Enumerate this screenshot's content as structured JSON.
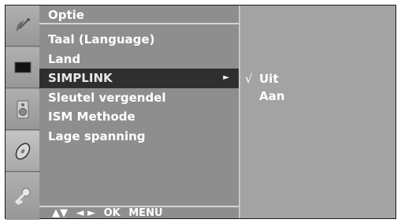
{
  "icons": [
    {
      "name": "satellite-dish-icon"
    },
    {
      "name": "screen-icon"
    },
    {
      "name": "speaker-icon"
    },
    {
      "name": "disc-icon"
    },
    {
      "name": "key-icon"
    }
  ],
  "menu": {
    "title": "Optie",
    "items": [
      {
        "label": "Taal (Language)"
      },
      {
        "label": "Land"
      },
      {
        "label": "SIMPLINK",
        "selected": true,
        "arrow": "►"
      },
      {
        "label": "Sleutel vergendel"
      },
      {
        "label": "ISM Methode"
      },
      {
        "label": "Lage spanning"
      }
    ],
    "footer": {
      "updown": "▲▼",
      "leftright": "◄ ►",
      "ok": "OK",
      "menu": "MENU"
    }
  },
  "submenu": {
    "items": [
      {
        "check": "√",
        "label": "Uit"
      },
      {
        "check": "",
        "label": "Aan"
      }
    ]
  },
  "colors": {
    "selected_bg": "#2f2f2f",
    "menu_bg": "#8e8e8e",
    "submenu_bg": "#a3a3a3"
  }
}
